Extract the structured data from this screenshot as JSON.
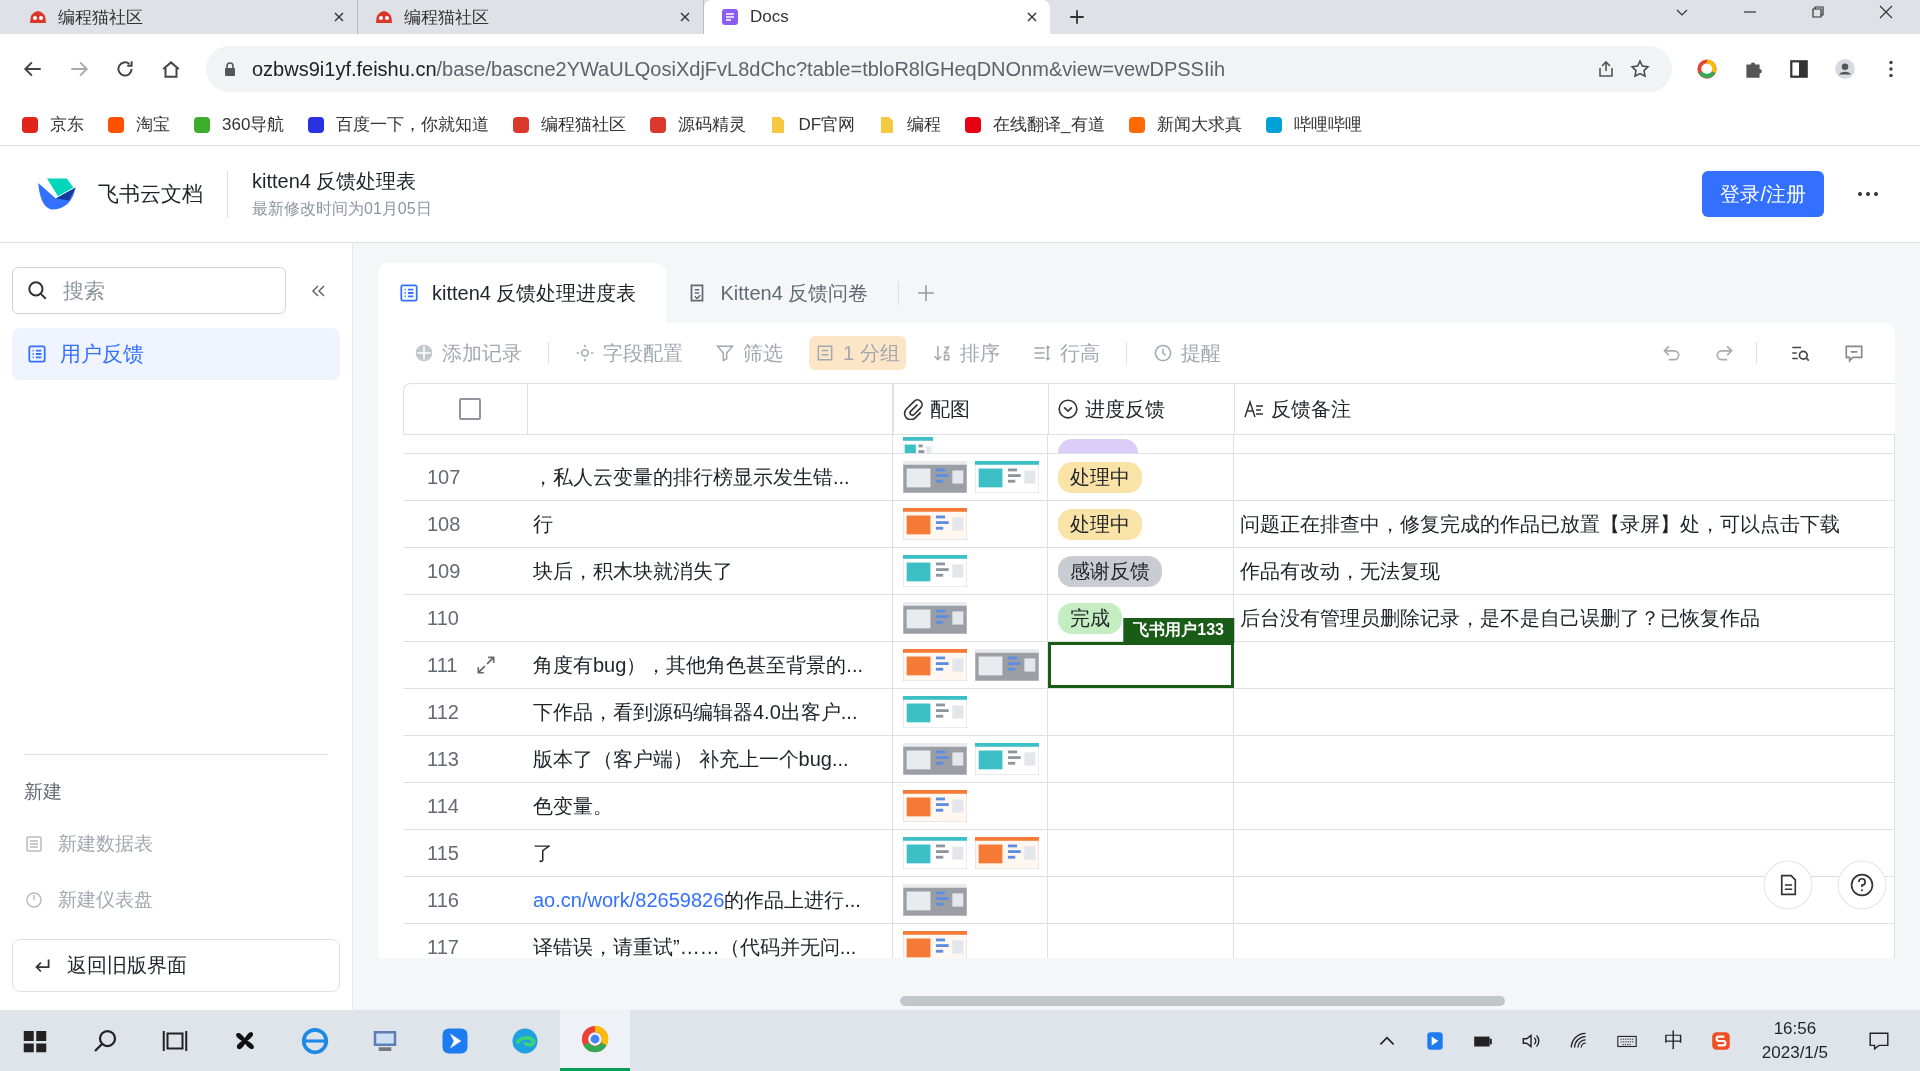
{
  "browser": {
    "tabs": [
      {
        "title": "编程猫社区",
        "kind": "site",
        "selected": false
      },
      {
        "title": "编程猫社区",
        "kind": "site",
        "selected": false
      },
      {
        "title": "Docs",
        "kind": "docs",
        "selected": true
      }
    ],
    "url": {
      "host": "ozbws9i1yf.feishu.cn",
      "path": "/base/bascne2YWaULQosiXdjFvL8dChc?table=tbloR8lGHeqDNOnm&view=vewDPSSIih"
    },
    "bookmarks": [
      {
        "label": "京东",
        "kind": "site",
        "color": "#e1251b"
      },
      {
        "label": "淘宝",
        "kind": "site",
        "color": "#ff5000"
      },
      {
        "label": "360导航",
        "kind": "site",
        "color": "#3dae2b"
      },
      {
        "label": "百度一下，你就知道",
        "kind": "site",
        "color": "#2932e1"
      },
      {
        "label": "编程猫社区",
        "kind": "site",
        "color": "#d9382a"
      },
      {
        "label": "源码精灵",
        "kind": "site",
        "color": "#d9382a"
      },
      {
        "label": "DF官网",
        "kind": "folder",
        "color": "#f5c842"
      },
      {
        "label": "编程",
        "kind": "folder",
        "color": "#f5c842"
      },
      {
        "label": "在线翻译_有道",
        "kind": "site",
        "color": "#e60012"
      },
      {
        "label": "新闻大求真",
        "kind": "site",
        "color": "#ff6a00"
      },
      {
        "label": "哔哩哔哩",
        "kind": "site",
        "color": "#00a1d6"
      }
    ]
  },
  "app": {
    "brand": "飞书云文档",
    "title": "kitten4 反馈处理表",
    "subtitle": "最新修改时间为01月05日",
    "login_button": "登录/注册"
  },
  "sidebar": {
    "search": {
      "placeholder": "搜索"
    },
    "items": [
      {
        "label": "用户反馈",
        "selected": true
      }
    ],
    "new_heading": "新建",
    "new_items": [
      {
        "label": "新建数据表",
        "kind": "table"
      },
      {
        "label": "新建仪表盘",
        "kind": "dashboard"
      }
    ],
    "back_button": "返回旧版界面"
  },
  "tabs": [
    {
      "label": "kitten4 反馈处理进度表",
      "kind": "table",
      "selected": true
    },
    {
      "label": "Kitten4 反馈问卷",
      "kind": "form",
      "selected": false
    }
  ],
  "toolbar": [
    {
      "label": "添加记录",
      "kind": "add",
      "active": false
    },
    {
      "label": "字段配置",
      "kind": "settings",
      "active": false
    },
    {
      "label": "筛选",
      "kind": "filter",
      "active": false
    },
    {
      "label": "1 分组",
      "kind": "group",
      "active": true
    },
    {
      "label": "排序",
      "kind": "sort",
      "active": false
    },
    {
      "label": "行高",
      "kind": "row-height",
      "active": false
    },
    {
      "label": "提醒",
      "kind": "reminder",
      "active": false
    }
  ],
  "table": {
    "header_checkbox": {
      "checked": false
    },
    "columns": [
      {
        "label": "配图",
        "kind": "attachment"
      },
      {
        "label": "进度反馈",
        "kind": "status"
      },
      {
        "label": "反馈备注",
        "kind": "note"
      }
    ],
    "rows": [
      {
        "kind": "partial",
        "status": {
          "color": "#dccdf8"
        },
        "active": false,
        "hovered": false
      },
      {
        "kind": "record",
        "number": "107",
        "text": "，私人云变量的排行榜显示发生错...",
        "status": {
          "text": "处理中",
          "color": "#f9e3a6"
        },
        "active": false,
        "hovered": false
      },
      {
        "kind": "record",
        "number": "108",
        "text": "行",
        "status": {
          "text": "处理中",
          "color": "#f9e3a6"
        },
        "note": "问题正在排查中，修复完成的作品已放置【录屏】处，可以点击下载",
        "active": false,
        "hovered": false
      },
      {
        "kind": "record",
        "number": "109",
        "text": "块后，积木块就消失了",
        "status": {
          "text": "感谢反馈",
          "color": "#c9ccd2"
        },
        "note": "作品有改动，无法复现",
        "active": false,
        "hovered": false
      },
      {
        "kind": "record",
        "number": "110",
        "status": {
          "text": "完成",
          "color": "#c4eec2"
        },
        "note": "后台没有管理员删除记录，是不是自己误删了？已恢复作品",
        "active": false,
        "hovered": false
      },
      {
        "kind": "record",
        "number": "111",
        "text": "角度有bug），其他角色甚至背景的...",
        "active": true,
        "hovered": true,
        "cursor_label": "飞书用户133"
      },
      {
        "kind": "record",
        "number": "112",
        "text": "下作品，看到源码编辑器4.0出客户...",
        "active": false,
        "hovered": false
      },
      {
        "kind": "record",
        "number": "113",
        "text": "版本了（客户端） 补充上一个bug...",
        "active": false,
        "hovered": false
      },
      {
        "kind": "record",
        "number": "114",
        "text": "色变量。",
        "active": false,
        "hovered": false
      },
      {
        "kind": "record",
        "number": "115",
        "text": "了",
        "active": false,
        "hovered": false
      },
      {
        "kind": "record",
        "number": "116",
        "link": "ao.cn/work/82659826",
        "text": "的作品上进行...",
        "active": false,
        "hovered": false
      },
      {
        "kind": "record",
        "number": "117",
        "text": "译错误，请重试”……（代码并无问...",
        "active": false,
        "hovered": false
      }
    ]
  },
  "taskbar": {
    "ime": "中",
    "time": "16:56",
    "date": "2023/1/5"
  }
}
